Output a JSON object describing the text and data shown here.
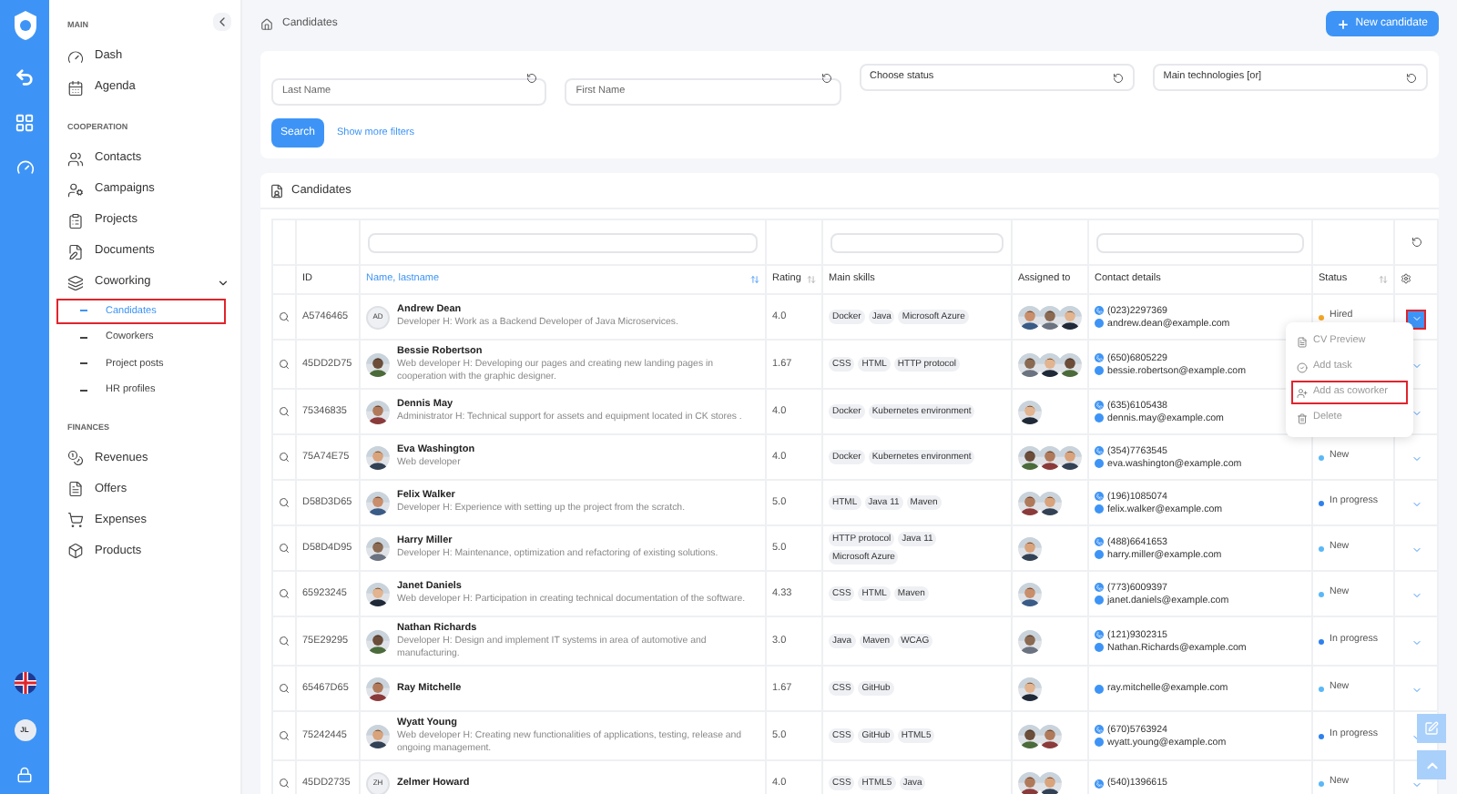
{
  "rail": {
    "avatar_initials": "JL"
  },
  "sidebar": {
    "sections": [
      {
        "title": "MAIN",
        "items": [
          {
            "label": "Dash"
          },
          {
            "label": "Agenda"
          }
        ]
      },
      {
        "title": "COOPERATION",
        "items": [
          {
            "label": "Contacts"
          },
          {
            "label": "Campaigns"
          },
          {
            "label": "Projects"
          },
          {
            "label": "Documents"
          },
          {
            "label": "Coworking",
            "expanded": true,
            "children": [
              {
                "label": "Candidates",
                "selected": true,
                "highlighted": true
              },
              {
                "label": "Coworkers",
                "selected": false,
                "highlighted": false
              },
              {
                "label": "Project posts",
                "selected": false,
                "highlighted": false
              },
              {
                "label": "HR profiles",
                "selected": false,
                "highlighted": false
              }
            ]
          }
        ]
      },
      {
        "title": "FINANCES",
        "items": [
          {
            "label": "Revenues"
          },
          {
            "label": "Offers"
          },
          {
            "label": "Expenses"
          },
          {
            "label": "Products"
          }
        ]
      }
    ]
  },
  "breadcrumb": "Candidates",
  "new_button": "New candidate",
  "filters": {
    "fields": [
      {
        "kind": "input",
        "placeholder": "Last Name"
      },
      {
        "kind": "input",
        "placeholder": "First Name"
      },
      {
        "kind": "select",
        "value": "Choose status"
      },
      {
        "kind": "select",
        "value": "Main technologies [or]"
      }
    ],
    "search_button": "Search",
    "more_link": "Show more filters"
  },
  "table": {
    "title": "Candidates",
    "columns": [
      {
        "label": "ID",
        "sortable": false,
        "active": false
      },
      {
        "label": "Name, lastname",
        "sortable": true,
        "active": true
      },
      {
        "label": "Rating",
        "sortable": true,
        "active": false
      },
      {
        "label": "Main skills",
        "sortable": false,
        "active": false
      },
      {
        "label": "Assigned to",
        "sortable": false,
        "active": false
      },
      {
        "label": "Contact details",
        "sortable": false,
        "active": false
      },
      {
        "label": "Status",
        "sortable": true,
        "active": false
      }
    ],
    "rows": [
      {
        "id": "A5746465",
        "avatar": {
          "kind": "initials",
          "text": "AD"
        },
        "name": "Andrew Dean",
        "description": "Developer H: Work as a Backend Developer of Java Microservices.",
        "rating": "4.0",
        "skills": [
          "Docker",
          "Java",
          "Microsoft Azure"
        ],
        "assigned": [
          {
            "kind": "picture"
          },
          {
            "kind": "picture"
          },
          {
            "kind": "picture"
          }
        ],
        "phone": "(023)2297369",
        "email": "andrew.dean@example.com",
        "status": {
          "label": "Hired",
          "color": "#f5a524"
        },
        "menu_open": true
      },
      {
        "id": "45DD2D75",
        "avatar": {
          "kind": "picture"
        },
        "name": "Bessie Robertson",
        "description": "Web developer H: Developing our pages and creating new landing pages in cooperation with the graphic designer.",
        "rating": "1.67",
        "skills": [
          "CSS",
          "HTML",
          "HTTP protocol"
        ],
        "assigned": [
          {
            "kind": "picture"
          },
          {
            "kind": "picture"
          },
          {
            "kind": "picture"
          }
        ],
        "phone": "(650)6805229",
        "email": "bessie.robertson@example.com",
        "menu_open": false
      },
      {
        "id": "75346835",
        "avatar": {
          "kind": "picture"
        },
        "name": "Dennis May",
        "description": "Administrator H: Technical support for assets and equipment located in CK stores .",
        "rating": "4.0",
        "skills": [
          "Docker",
          "Kubernetes environment"
        ],
        "assigned": [
          {
            "kind": "picture"
          }
        ],
        "phone": "(635)6105438",
        "email": "dennis.may@example.com",
        "menu_open": false
      },
      {
        "id": "75A74E75",
        "avatar": {
          "kind": "picture"
        },
        "name": "Eva Washington",
        "description": "Web developer",
        "rating": "4.0",
        "skills": [
          "Docker",
          "Kubernetes environment"
        ],
        "assigned": [
          {
            "kind": "picture"
          },
          {
            "kind": "picture"
          },
          {
            "kind": "picture"
          }
        ],
        "phone": "(354)7763545",
        "email": "eva.washington@example.com",
        "status": {
          "label": "New",
          "color": "#5ab8f7"
        },
        "menu_open": false
      },
      {
        "id": "D58D3D65",
        "avatar": {
          "kind": "picture"
        },
        "name": "Felix Walker",
        "description": "Developer H: Experience with setting up the project from the scratch.",
        "rating": "5.0",
        "skills": [
          "HTML",
          "Java 11",
          "Maven"
        ],
        "assigned": [
          {
            "kind": "picture"
          },
          {
            "kind": "picture"
          }
        ],
        "phone": "(196)1085074",
        "email": "felix.walker@example.com",
        "status": {
          "label": "In progress",
          "color": "#2f80ed"
        },
        "menu_open": false
      },
      {
        "id": "D58D4D95",
        "avatar": {
          "kind": "picture"
        },
        "name": "Harry Miller",
        "description": "Developer H: Maintenance, optimization and refactoring of existing solutions.",
        "rating": "5.0",
        "skills": [
          "HTTP protocol",
          "Java 11",
          "Microsoft Azure"
        ],
        "assigned": [
          {
            "kind": "picture"
          }
        ],
        "phone": "(488)6641653",
        "email": "harry.miller@example.com",
        "status": {
          "label": "New",
          "color": "#5ab8f7"
        },
        "menu_open": false
      },
      {
        "id": "65923245",
        "avatar": {
          "kind": "picture"
        },
        "name": "Janet Daniels",
        "description": "Web developer H: Participation in creating technical documentation of the software.",
        "rating": "4.33",
        "skills": [
          "CSS",
          "HTML",
          "Maven"
        ],
        "assigned": [
          {
            "kind": "picture"
          }
        ],
        "phone": "(773)6009397",
        "email": "janet.daniels@example.com",
        "status": {
          "label": "New",
          "color": "#5ab8f7"
        },
        "menu_open": false
      },
      {
        "id": "75E29295",
        "avatar": {
          "kind": "picture"
        },
        "name": "Nathan Richards",
        "description": "Developer H: Design and implement IT systems in area of automotive and manufacturing.",
        "rating": "3.0",
        "skills": [
          "Java",
          "Maven",
          "WCAG"
        ],
        "assigned": [
          {
            "kind": "picture"
          }
        ],
        "phone": "(121)9302315",
        "email": "Nathan.Richards@example.com",
        "status": {
          "label": "In progress",
          "color": "#2f80ed"
        },
        "menu_open": false
      },
      {
        "id": "65467D65",
        "avatar": {
          "kind": "picture"
        },
        "name": "Ray Mitchelle",
        "rating": "1.67",
        "skills": [
          "CSS",
          "GitHub"
        ],
        "assigned": [
          {
            "kind": "picture"
          }
        ],
        "email": "ray.mitchelle@example.com",
        "status": {
          "label": "New",
          "color": "#5ab8f7"
        },
        "menu_open": false
      },
      {
        "id": "75242445",
        "avatar": {
          "kind": "picture"
        },
        "name": "Wyatt Young",
        "description": "Web developer H: Creating new functionalities of applications, testing, release and ongoing management.",
        "rating": "5.0",
        "skills": [
          "CSS",
          "GitHub",
          "HTML5"
        ],
        "assigned": [
          {
            "kind": "picture"
          },
          {
            "kind": "picture"
          }
        ],
        "phone": "(670)5763924",
        "email": "wyatt.young@example.com",
        "status": {
          "label": "In progress",
          "color": "#2f80ed"
        },
        "menu_open": false
      },
      {
        "id": "45DD2735",
        "avatar": {
          "kind": "initials",
          "text": "ZH"
        },
        "name": "Zelmer Howard",
        "rating": "4.0",
        "skills": [
          "CSS",
          "HTML5",
          "Java"
        ],
        "assigned": [
          {
            "kind": "picture"
          },
          {
            "kind": "picture"
          }
        ],
        "phone": "(540)1396615",
        "status": {
          "label": "New",
          "color": "#5ab8f7"
        },
        "menu_open": false
      }
    ]
  },
  "row_menu": [
    {
      "label": "CV Preview",
      "highlighted": false
    },
    {
      "label": "Add task",
      "highlighted": false
    },
    {
      "label": "Add as coworker",
      "highlighted": true
    },
    {
      "label": "Delete",
      "highlighted": false
    }
  ]
}
